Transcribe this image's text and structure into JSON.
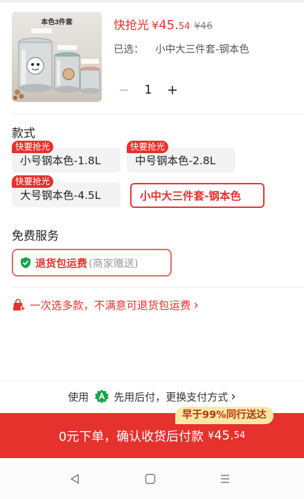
{
  "product": {
    "thumb_caption": "本色3件套",
    "flash_label": "快抢光",
    "price_symbol": "¥",
    "price_int": "45.",
    "price_dec": "54",
    "price_old": "¥46",
    "selected_prefix": "已选：",
    "selected_value": "小中大三件套-钢本色",
    "quantity": "1"
  },
  "style_section": {
    "title": "款式",
    "options": [
      {
        "label": "小号钢本色-1.8L",
        "tag": "快要抢光"
      },
      {
        "label": "中号钢本色-2.8L",
        "tag": "快要抢光"
      },
      {
        "label": "大号钢本色-4.5L",
        "tag": "快要抢光"
      },
      {
        "label": "小中大三件套-钢本色",
        "tag": ""
      }
    ]
  },
  "service_section": {
    "title": "免费服务",
    "service_strong": "退货包运费",
    "service_light": "(商家赠送)"
  },
  "promo": {
    "text": "一次选多款，不满意可退货包运费",
    "chevron": "›"
  },
  "payment": {
    "prefix": "使用",
    "method": "先用后付，更换支付方式",
    "chevron": "›"
  },
  "cta": {
    "badge": "早于99%同行送达",
    "text": "0元下单，确认收货后付款",
    "symbol": "¥",
    "amount_int": "45.",
    "amount_dec": "54"
  },
  "colors": {
    "accent": "#e5322d",
    "badge_bg": "#fde6a6",
    "option_bg": "#f3f3f3",
    "pay_green": "#1aa34a"
  },
  "icons": [
    "minus-icon",
    "plus-icon",
    "shield-check-icon",
    "gift-bag-icon",
    "pay-later-logo-icon",
    "nav-back-icon",
    "nav-home-icon",
    "nav-menu-icon"
  ]
}
